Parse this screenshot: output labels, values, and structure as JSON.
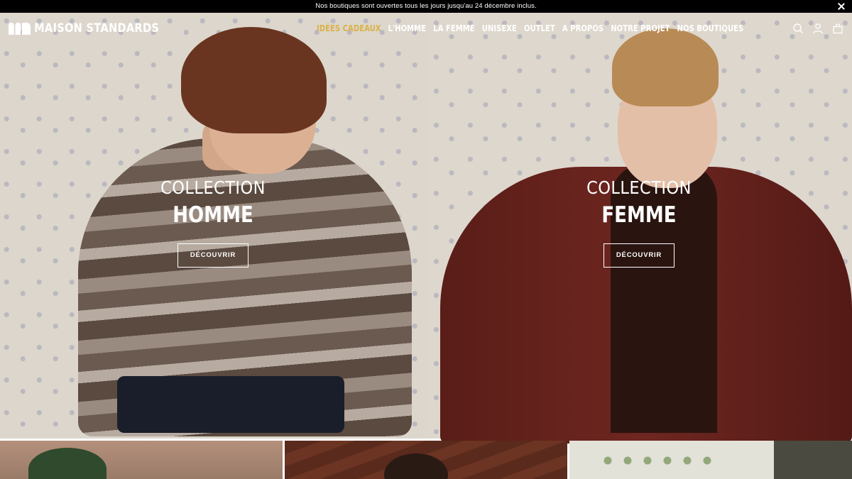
{
  "announcement": {
    "text": "Nos boutiques sont ouvertes tous les jours jusqu'au 24 décembre inclus."
  },
  "brand": {
    "name": "MAISON STANDARDS"
  },
  "nav": {
    "items": [
      {
        "label": "IDÉES CADEAUX",
        "active": true
      },
      {
        "label": "L'HOMME"
      },
      {
        "label": "LA FEMME"
      },
      {
        "label": "UNISEXE"
      },
      {
        "label": "OUTLET"
      },
      {
        "label": "A PROPOS"
      },
      {
        "label": "NOTRE PROJET"
      },
      {
        "label": "NOS BOUTIQUES"
      }
    ],
    "active_color": "#d9b24a"
  },
  "header_icons": [
    "search-icon",
    "account-icon",
    "cart-icon"
  ],
  "hero": {
    "left": {
      "line1": "COLLECTION",
      "line2": "HOMME",
      "cta": "DÉCOUVRIR"
    },
    "right": {
      "line1": "COLLECTION",
      "line2": "FEMME",
      "cta": "DÉCOUVRIR"
    }
  }
}
